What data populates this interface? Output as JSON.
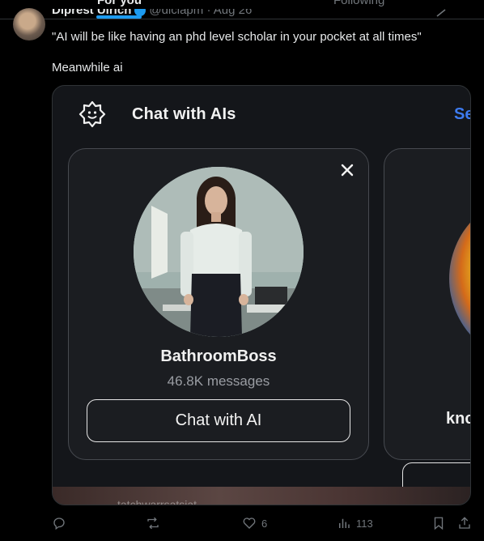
{
  "tabs": [
    {
      "label": "For you",
      "active": true
    },
    {
      "label": "Following",
      "active": false
    }
  ],
  "tweet": {
    "author_name": "Diprest Ulrich",
    "author_handle": "@diciapm",
    "time": "Aug 26",
    "text": "\"AI will be like having an phd level scholar in your pocket at all times\"",
    "text_line2": "Meanwhile ai"
  },
  "media": {
    "title": "Chat with AIs",
    "see_all": "See all",
    "cards": [
      {
        "name": "BathroomBoss",
        "messages": "46.8K messages",
        "button": "Chat with AI"
      },
      {
        "name": "knc",
        "messages": "",
        "button": ""
      }
    ],
    "footer_text": "tatchwarrsatsiat"
  },
  "actions": {
    "replies": "",
    "retweets": "",
    "likes": "6",
    "views": "113"
  },
  "colors": {
    "accent": "#1d9bf0",
    "see_all": "#3d7bf0",
    "background": "#000000",
    "card": "#1b1d21"
  }
}
